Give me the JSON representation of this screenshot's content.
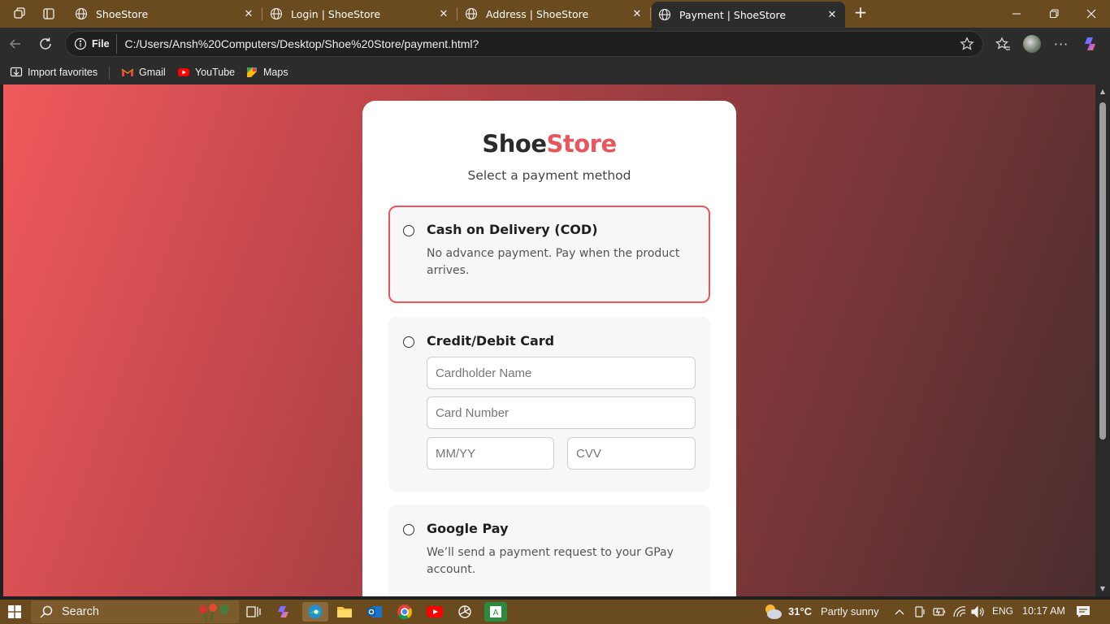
{
  "browser": {
    "tabs": [
      {
        "title": "ShoeStore",
        "active": false
      },
      {
        "title": "Login | ShoeStore",
        "active": false
      },
      {
        "title": "Address | ShoeStore",
        "active": false
      },
      {
        "title": "Payment | ShoeStore",
        "active": true
      }
    ],
    "site_chip": "File",
    "url": "C:/Users/Ansh%20Computers/Desktop/Shoe%20Store/payment.html?",
    "favorites": [
      {
        "label": "Import favorites"
      },
      {
        "label": "Gmail"
      },
      {
        "label": "YouTube"
      },
      {
        "label": "Maps"
      }
    ]
  },
  "page": {
    "brand_part1": "Shoe",
    "brand_part2": "Store",
    "subtitle": "Select a payment method",
    "options": [
      {
        "title": "Cash on Delivery (COD)",
        "description": "No advance payment. Pay when the product arrives.",
        "selected": true
      },
      {
        "title": "Credit/Debit Card",
        "selected": false,
        "fields": {
          "cardholder": "Cardholder Name",
          "number": "Card Number",
          "expiry": "MM/YY",
          "cvv": "CVV"
        }
      },
      {
        "title": "Google Pay",
        "description": "We’ll send a payment request to your GPay account.",
        "selected": false
      }
    ]
  },
  "taskbar": {
    "search_label": "Search",
    "weather": {
      "temp": "31°C",
      "condition": "Partly sunny"
    },
    "language": "ENG",
    "time": "10:17 AM"
  },
  "colors": {
    "accent": "#e9555a",
    "tab_strip": "#6a4a1f",
    "gradient_start": "#f05a5c",
    "gradient_end": "#4a2d2e"
  }
}
